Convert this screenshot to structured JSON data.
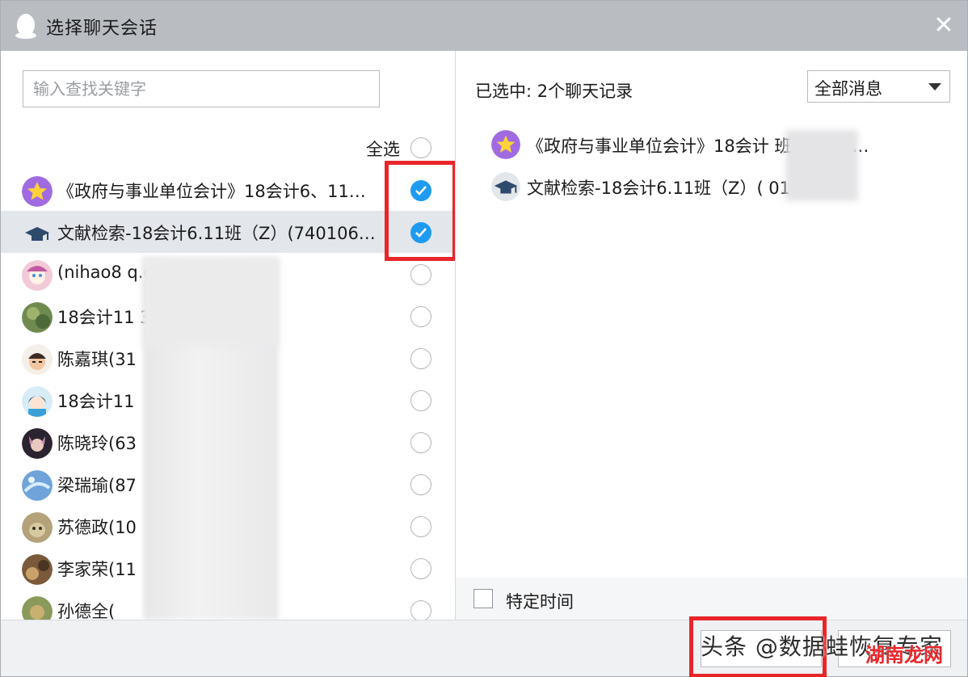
{
  "window": {
    "title": "选择聊天会话",
    "close_glyph": "✕"
  },
  "left": {
    "search_placeholder": "输入查找关键字",
    "select_all_label": "全选",
    "items": [
      {
        "label": "《政府与事业单位会计》18会计6、11…",
        "avatar": "star-group-avatar",
        "checked": true,
        "highlighted": false
      },
      {
        "label": "文献检索-18会计6.11班（Z）(740106…",
        "avatar": "graduation-cap-avatar",
        "checked": true,
        "highlighted": true
      },
      {
        "label": "(nihao8                    q.com)",
        "avatar": "user-avatar-1",
        "checked": false,
        "highlighted": false
      },
      {
        "label": "18会计11                    35866)",
        "avatar": "user-avatar-2",
        "checked": false,
        "highlighted": false
      },
      {
        "label": "陈嘉琪(31",
        "avatar": "user-avatar-3",
        "checked": false,
        "highlighted": false
      },
      {
        "label": "18会计11",
        "avatar": "user-avatar-4",
        "checked": false,
        "highlighted": false
      },
      {
        "label": "陈晓玲(63",
        "avatar": "user-avatar-5",
        "checked": false,
        "highlighted": false
      },
      {
        "label": "梁瑞瑜(87",
        "avatar": "user-avatar-6",
        "checked": false,
        "highlighted": false
      },
      {
        "label": "苏德政(10",
        "avatar": "user-avatar-7",
        "checked": false,
        "highlighted": false
      },
      {
        "label": "李家荣(11",
        "avatar": "user-avatar-8",
        "checked": false,
        "highlighted": false
      },
      {
        "label": "孙德全(",
        "avatar": "user-avatar-9",
        "checked": false,
        "highlighted": false
      }
    ]
  },
  "right": {
    "selected_count": "已选中: 2个聊天记录",
    "filter_value": "全部消息",
    "selected_items": [
      {
        "label": "《政府与事业单位会计》18会计              班(54362…"
      },
      {
        "label": "文献检索-18会计6.11班（Z）(              014)"
      }
    ],
    "time_label": "特定时间"
  },
  "footer": {
    "ok_label": "",
    "cancel_label": "",
    "watermark": "头条 @数据蛙恢复专家",
    "watermark_badge": "湖南龙网"
  },
  "colors": {
    "titlebar": "#b9bcc1",
    "check_blue": "#1e9bf0",
    "highlight_row": "#e3e6ea",
    "annotation_red": "#e8262a"
  }
}
